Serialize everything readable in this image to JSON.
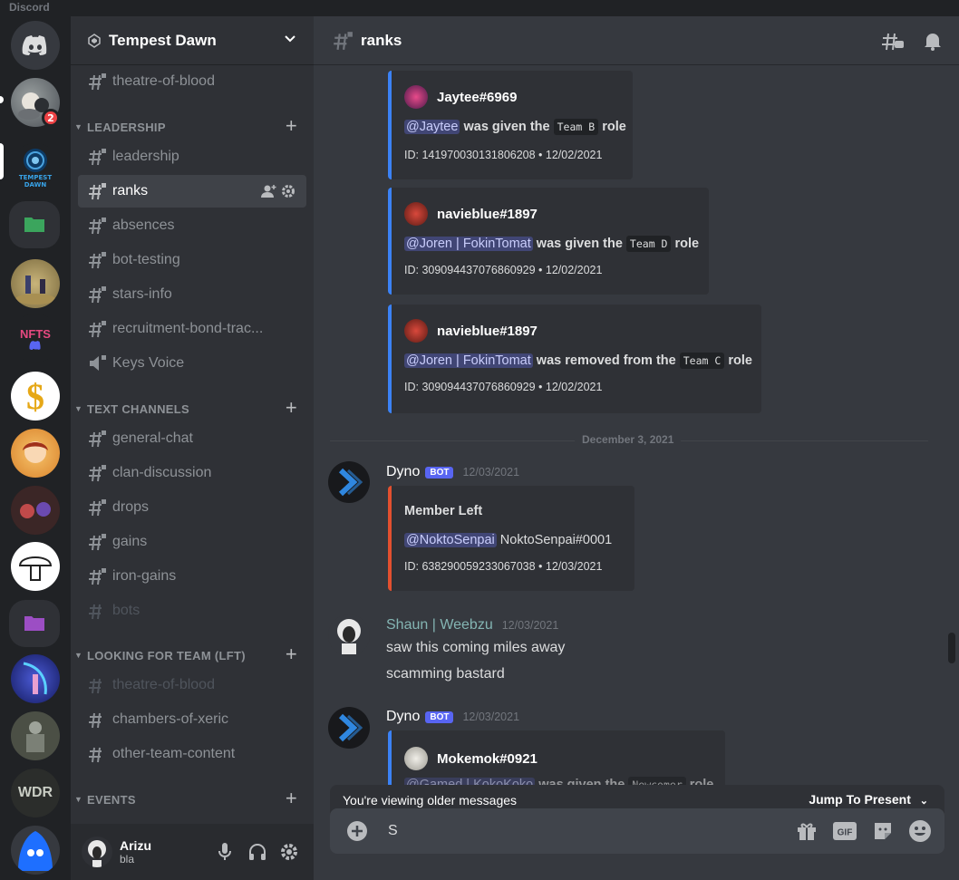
{
  "window": {
    "app_name": "Discord"
  },
  "rail": {
    "unread_badge": "2",
    "tempest_label": "TEMPEST DAWN",
    "nfts_label": "NFTS",
    "wdr_label": "WDR"
  },
  "server": {
    "name": "Tempest Dawn"
  },
  "channels": {
    "top": [
      {
        "name": "theatre-of-blood",
        "muted": false
      }
    ],
    "categories": [
      {
        "name": "LEADERSHIP",
        "items": [
          "leadership",
          "ranks",
          "absences",
          "bot-testing",
          "stars-info",
          "recruitment-bond-trac...",
          "Keys Voice"
        ]
      },
      {
        "name": "TEXT CHANNELS",
        "items": [
          "general-chat",
          "clan-discussion",
          "drops",
          "gains",
          "iron-gains",
          "bots"
        ]
      },
      {
        "name": "LOOKING FOR TEAM (LFT)",
        "items": [
          "theatre-of-blood",
          "chambers-of-xeric",
          "other-team-content"
        ]
      },
      {
        "name": "EVENTS",
        "items": []
      }
    ]
  },
  "user": {
    "name": "Arizu",
    "status": "bla"
  },
  "chat": {
    "channel": "ranks",
    "embeds": [
      {
        "author": "Jaytee#6969",
        "mention": "@Jaytee",
        "text1": "was given the",
        "role": "Team B",
        "text2": "role",
        "footer": "ID: 141970030131806208 • 12/02/2021"
      },
      {
        "author": "navieblue#1897",
        "mention": "@Joren | FokinTomat",
        "text1": "was given the",
        "role": "Team D",
        "text2": "role",
        "footer": "ID: 309094437076860929 • 12/02/2021"
      },
      {
        "author": "navieblue#1897",
        "mention": "@Joren | FokinTomat",
        "text1": "was removed from the",
        "role": "Team C",
        "text2": "role",
        "footer": "ID: 309094437076860929 • 12/02/2021"
      }
    ],
    "date_divider": "December 3, 2021",
    "messages": [
      {
        "author": "Dyno",
        "bot_tag": "BOT",
        "time": "12/03/2021",
        "embed": {
          "title": "Member Left",
          "mention": "@NoktoSenpai",
          "text": "NoktoSenpai#0001",
          "footer": "ID: 638290059233067038 • 12/03/2021"
        }
      },
      {
        "author": "Shaun | Weebzu",
        "time": "12/03/2021",
        "lines": [
          "saw this coming miles away",
          "scamming bastard"
        ]
      },
      {
        "author": "Dyno",
        "bot_tag": "BOT",
        "time": "12/03/2021",
        "embed": {
          "author": "Mokemok#0921",
          "partial": "was given the",
          "role": "Newcomer",
          "text2": "role"
        }
      }
    ],
    "older_bar": {
      "text": "You're viewing older messages",
      "jump": "Jump To Present"
    },
    "composer": {
      "value": "S"
    }
  }
}
